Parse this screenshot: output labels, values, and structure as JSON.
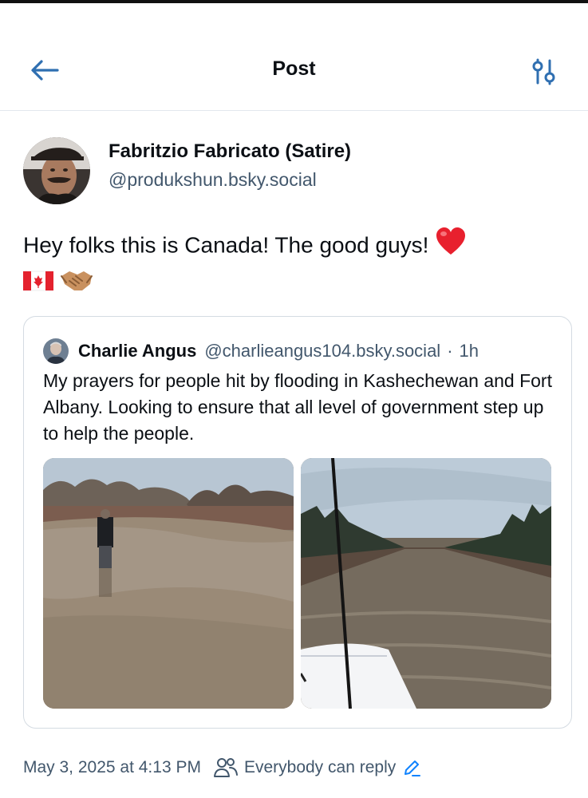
{
  "header": {
    "title": "Post",
    "back_icon": "arrow-left-icon",
    "filter_icon": "sliders-icon"
  },
  "post": {
    "author_name": "Fabritzio Fabricato (Satire)",
    "author_handle": "@produkshun.bsky.social",
    "text_line1": "Hey folks this is Canada! The good guys!",
    "emojis": [
      "red-heart",
      "canada-flag",
      "handshake"
    ],
    "timestamp": "May 3, 2025 at 4:13 PM",
    "reply_setting": "Everybody can reply"
  },
  "quote": {
    "author_name": "Charlie Angus",
    "author_handle": "@charlieangus104.bsky.social",
    "separator": "·",
    "time": "1h",
    "text": "My prayers for people hit by flooding in Kashechewan and Fort Albany. Looking to ensure that all level of government step up to help the people.",
    "images": [
      "flooded dirt road with person standing in water",
      "flooded road seen from boat bow with antenna"
    ]
  },
  "colors": {
    "accent": "#1083fe",
    "muted_text": "#42576c",
    "border": "#d4dbe2"
  }
}
